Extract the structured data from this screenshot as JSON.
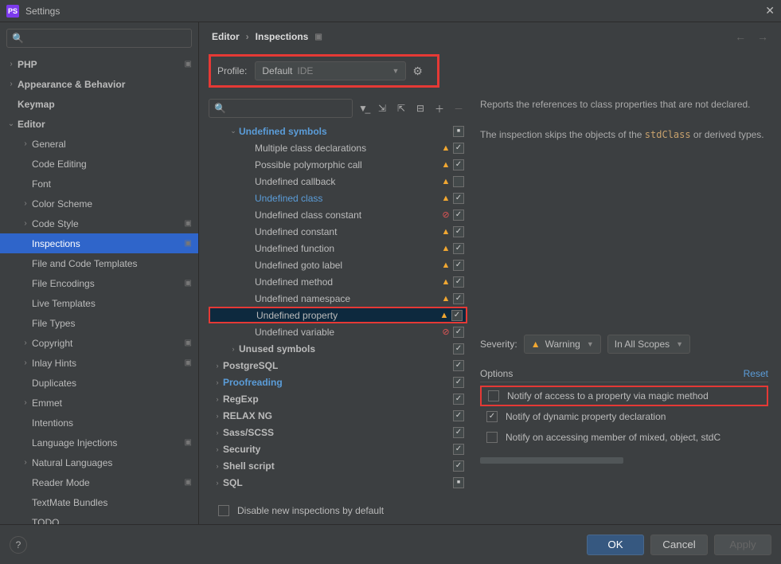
{
  "window": {
    "title": "Settings",
    "app_badge": "PS"
  },
  "breadcrumb": {
    "part1": "Editor",
    "part2": "Inspections"
  },
  "profile": {
    "label": "Profile:",
    "value": "Default",
    "scope": "IDE"
  },
  "sidebar": {
    "items": [
      {
        "label": "PHP",
        "level": 0,
        "arrow": ">",
        "bold": true,
        "bookmark": true
      },
      {
        "label": "Appearance & Behavior",
        "level": 0,
        "arrow": ">",
        "bold": true
      },
      {
        "label": "Keymap",
        "level": 0,
        "arrow": "",
        "bold": true
      },
      {
        "label": "Editor",
        "level": 0,
        "arrow": "v",
        "bold": true
      },
      {
        "label": "General",
        "level": 1,
        "arrow": ">"
      },
      {
        "label": "Code Editing",
        "level": 1,
        "arrow": ""
      },
      {
        "label": "Font",
        "level": 1,
        "arrow": ""
      },
      {
        "label": "Color Scheme",
        "level": 1,
        "arrow": ">"
      },
      {
        "label": "Code Style",
        "level": 1,
        "arrow": ">",
        "bookmark": true
      },
      {
        "label": "Inspections",
        "level": 1,
        "arrow": "",
        "selected": true,
        "bookmark": true
      },
      {
        "label": "File and Code Templates",
        "level": 1,
        "arrow": ""
      },
      {
        "label": "File Encodings",
        "level": 1,
        "arrow": "",
        "bookmark": true
      },
      {
        "label": "Live Templates",
        "level": 1,
        "arrow": ""
      },
      {
        "label": "File Types",
        "level": 1,
        "arrow": ""
      },
      {
        "label": "Copyright",
        "level": 1,
        "arrow": ">",
        "bookmark": true
      },
      {
        "label": "Inlay Hints",
        "level": 1,
        "arrow": ">",
        "bookmark": true
      },
      {
        "label": "Duplicates",
        "level": 1,
        "arrow": ""
      },
      {
        "label": "Emmet",
        "level": 1,
        "arrow": ">"
      },
      {
        "label": "Intentions",
        "level": 1,
        "arrow": ""
      },
      {
        "label": "Language Injections",
        "level": 1,
        "arrow": "",
        "bookmark": true
      },
      {
        "label": "Natural Languages",
        "level": 1,
        "arrow": ">"
      },
      {
        "label": "Reader Mode",
        "level": 1,
        "arrow": "",
        "bookmark": true
      },
      {
        "label": "TextMate Bundles",
        "level": 1,
        "arrow": ""
      },
      {
        "label": "TODO",
        "level": 1,
        "arrow": ""
      }
    ]
  },
  "inspections": [
    {
      "label": "Undefined symbols",
      "level": 1,
      "arrow": "v",
      "bold": true,
      "link": true,
      "cb": "mixed"
    },
    {
      "label": "Multiple class declarations",
      "level": 2,
      "sev": "warn",
      "cb": "checked"
    },
    {
      "label": "Possible polymorphic call",
      "level": 2,
      "sev": "warn",
      "cb": "checked"
    },
    {
      "label": "Undefined callback",
      "level": 2,
      "sev": "warn",
      "cb": ""
    },
    {
      "label": "Undefined class",
      "level": 2,
      "sev": "warn",
      "link": true,
      "cb": "checked"
    },
    {
      "label": "Undefined class constant",
      "level": 2,
      "sev": "err",
      "cb": "checked"
    },
    {
      "label": "Undefined constant",
      "level": 2,
      "sev": "warn",
      "cb": "checked"
    },
    {
      "label": "Undefined function",
      "level": 2,
      "sev": "warn",
      "cb": "checked"
    },
    {
      "label": "Undefined goto label",
      "level": 2,
      "sev": "warn",
      "cb": "checked"
    },
    {
      "label": "Undefined method",
      "level": 2,
      "sev": "warn",
      "cb": "checked"
    },
    {
      "label": "Undefined namespace",
      "level": 2,
      "sev": "warn",
      "cb": "checked"
    },
    {
      "label": "Undefined property",
      "level": 2,
      "sev": "warn",
      "cb": "checked",
      "selected": true,
      "highlighted": true
    },
    {
      "label": "Undefined variable",
      "level": 2,
      "sev": "err",
      "cb": "checked"
    },
    {
      "label": "Unused symbols",
      "level": 1,
      "arrow": ">",
      "bold": true,
      "cb": "checked"
    },
    {
      "label": "PostgreSQL",
      "level": 0,
      "arrow": ">",
      "bold": true,
      "cb": "checked"
    },
    {
      "label": "Proofreading",
      "level": 0,
      "arrow": ">",
      "bold": true,
      "link": true,
      "cb": "checked"
    },
    {
      "label": "RegExp",
      "level": 0,
      "arrow": ">",
      "bold": true,
      "cb": "checked"
    },
    {
      "label": "RELAX NG",
      "level": 0,
      "arrow": ">",
      "bold": true,
      "cb": "checked"
    },
    {
      "label": "Sass/SCSS",
      "level": 0,
      "arrow": ">",
      "bold": true,
      "cb": "checked"
    },
    {
      "label": "Security",
      "level": 0,
      "arrow": ">",
      "bold": true,
      "cb": "checked"
    },
    {
      "label": "Shell script",
      "level": 0,
      "arrow": ">",
      "bold": true,
      "cb": "checked"
    },
    {
      "label": "SQL",
      "level": 0,
      "arrow": ">",
      "bold": true,
      "cb": "mixed"
    }
  ],
  "description": {
    "line1": "Reports the references to class properties that are not declared.",
    "line2a": "The inspection skips the objects of the ",
    "line2code": "stdClass",
    "line2b": " or derived types."
  },
  "severity": {
    "label": "Severity:",
    "value": "Warning",
    "scope": "In All Scopes"
  },
  "options": {
    "heading": "Options",
    "reset": "Reset",
    "items": [
      {
        "label": "Notify of access to a property via magic method",
        "checked": false,
        "highlighted": true
      },
      {
        "label": "Notify of dynamic property declaration",
        "checked": true
      },
      {
        "label": "Notify on accessing member of mixed, object, stdC",
        "checked": false
      }
    ]
  },
  "disable_label": "Disable new inspections by default",
  "buttons": {
    "ok": "OK",
    "cancel": "Cancel",
    "apply": "Apply"
  }
}
